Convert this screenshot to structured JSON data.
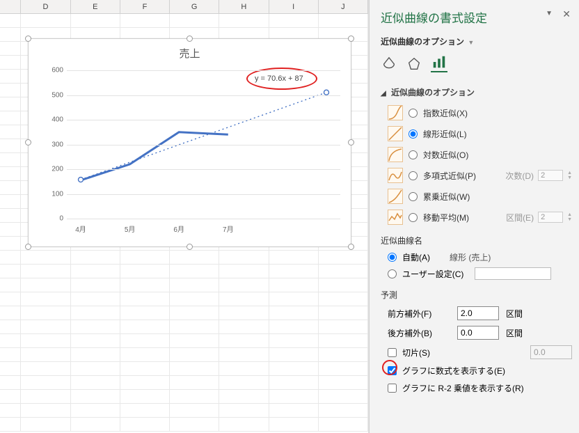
{
  "columns": [
    "D",
    "E",
    "F",
    "G",
    "H",
    "I",
    "J"
  ],
  "chart_data": {
    "type": "line",
    "title": "売上",
    "categories": [
      "4月",
      "5月",
      "6月",
      "7月"
    ],
    "series": [
      {
        "name": "売上",
        "values": [
          155,
          220,
          350,
          340
        ]
      }
    ],
    "trendline": {
      "equation": "y = 70.6x + 87",
      "forecast_forward": 2.0,
      "forecast_backward": 0.0,
      "type": "linear"
    },
    "ylim": [
      0,
      600
    ],
    "yticks": [
      0,
      100,
      200,
      300,
      400,
      500,
      600
    ]
  },
  "pane": {
    "title": "近似曲線の書式設定",
    "dropdown": "近似曲線のオプション",
    "section": "近似曲線のオプション",
    "trend_types": {
      "exponential": "指数近似(X)",
      "linear": "線形近似(L)",
      "logarithmic": "対数近似(O)",
      "polynomial": "多項式近似(P)",
      "power": "累乗近似(W)",
      "moving_avg": "移動平均(M)"
    },
    "poly_order_label": "次数(D)",
    "poly_order_value": "2",
    "movavg_period_label": "区間(E)",
    "movavg_period_value": "2",
    "name_section": "近似曲線名",
    "name_auto": "自動(A)",
    "name_auto_value": "線形 (売上)",
    "name_user": "ユーザー設定(C)",
    "forecast_section": "予測",
    "fwd_label": "前方補外(F)",
    "fwd_value": "2.0",
    "bwd_label": "後方補外(B)",
    "bwd_value": "0.0",
    "period_unit": "区間",
    "intercept_label": "切片(S)",
    "intercept_value": "0.0",
    "show_eq": "グラフに数式を表示する(E)",
    "show_r2": "グラフに R-2 乗値を表示する(R)"
  }
}
